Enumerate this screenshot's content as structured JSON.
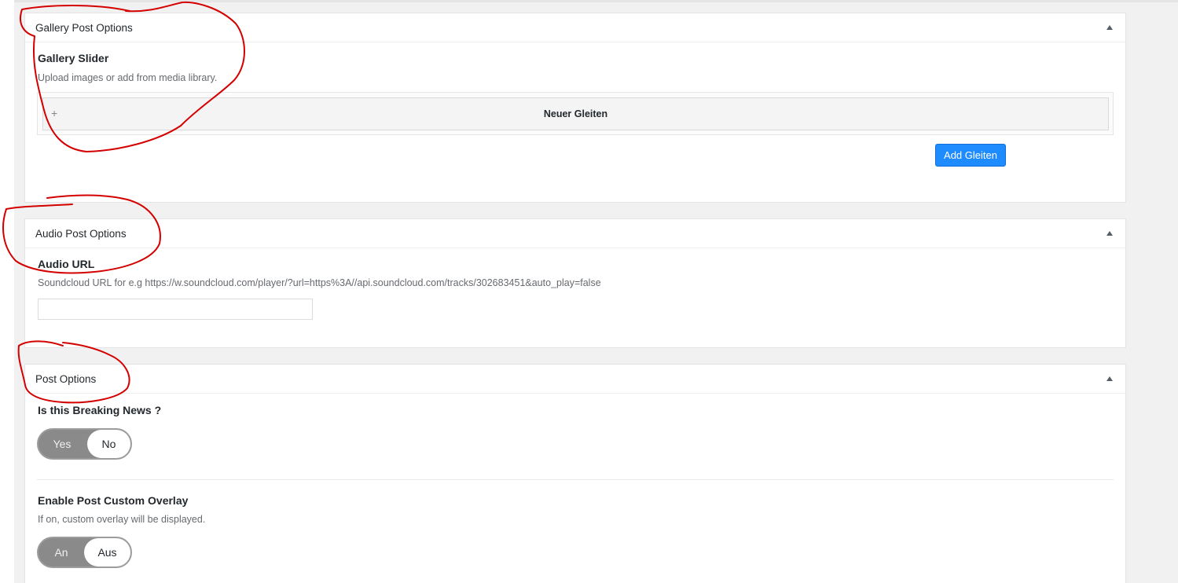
{
  "gallery_box": {
    "title": "Gallery Post Options",
    "field_title": "Gallery Slider",
    "field_desc": "Upload images or add from media library.",
    "row_label": "Neuer Gleiten",
    "row_icon": "+",
    "add_button_label": "Add Gleiten"
  },
  "audio_box": {
    "title": "Audio Post Options",
    "field_title": "Audio URL",
    "field_desc": "Soundcloud URL for e.g https://w.soundcloud.com/player/?url=https%3A//api.soundcloud.com/tracks/302683451&auto_play=false",
    "input_value": ""
  },
  "post_box": {
    "title": "Post Options",
    "breaking": {
      "field_title": "Is this Breaking News ?",
      "off_option": "Yes",
      "selected_option": "No"
    },
    "overlay": {
      "field_title": "Enable Post Custom Overlay",
      "field_desc": "If on, custom overlay will be displayed.",
      "off_option": "An",
      "selected_option": "Aus"
    }
  },
  "icons": {
    "collapse": "triangle-up-icon",
    "add_row": "plus-icon"
  },
  "colors": {
    "primary_button": "#1e8cff",
    "switch_track": "#8a8a8a",
    "annotation": "#d40000"
  }
}
